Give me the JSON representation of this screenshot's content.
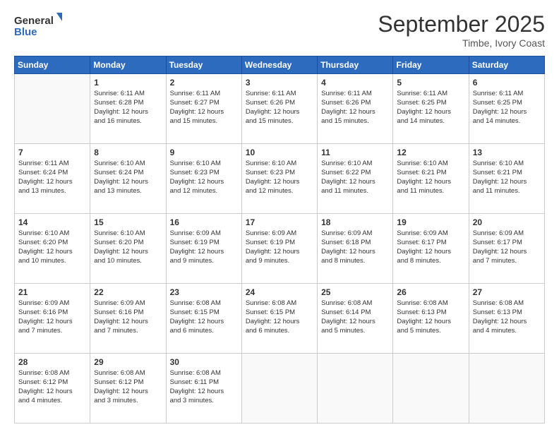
{
  "logo": {
    "line1": "General",
    "line2": "Blue"
  },
  "title": "September 2025",
  "subtitle": "Timbe, Ivory Coast",
  "days": [
    "Sunday",
    "Monday",
    "Tuesday",
    "Wednesday",
    "Thursday",
    "Friday",
    "Saturday"
  ],
  "weeks": [
    [
      {
        "num": "",
        "info": ""
      },
      {
        "num": "1",
        "info": "Sunrise: 6:11 AM\nSunset: 6:28 PM\nDaylight: 12 hours\nand 16 minutes."
      },
      {
        "num": "2",
        "info": "Sunrise: 6:11 AM\nSunset: 6:27 PM\nDaylight: 12 hours\nand 15 minutes."
      },
      {
        "num": "3",
        "info": "Sunrise: 6:11 AM\nSunset: 6:26 PM\nDaylight: 12 hours\nand 15 minutes."
      },
      {
        "num": "4",
        "info": "Sunrise: 6:11 AM\nSunset: 6:26 PM\nDaylight: 12 hours\nand 15 minutes."
      },
      {
        "num": "5",
        "info": "Sunrise: 6:11 AM\nSunset: 6:25 PM\nDaylight: 12 hours\nand 14 minutes."
      },
      {
        "num": "6",
        "info": "Sunrise: 6:11 AM\nSunset: 6:25 PM\nDaylight: 12 hours\nand 14 minutes."
      }
    ],
    [
      {
        "num": "7",
        "info": "Sunrise: 6:11 AM\nSunset: 6:24 PM\nDaylight: 12 hours\nand 13 minutes."
      },
      {
        "num": "8",
        "info": "Sunrise: 6:10 AM\nSunset: 6:24 PM\nDaylight: 12 hours\nand 13 minutes."
      },
      {
        "num": "9",
        "info": "Sunrise: 6:10 AM\nSunset: 6:23 PM\nDaylight: 12 hours\nand 12 minutes."
      },
      {
        "num": "10",
        "info": "Sunrise: 6:10 AM\nSunset: 6:23 PM\nDaylight: 12 hours\nand 12 minutes."
      },
      {
        "num": "11",
        "info": "Sunrise: 6:10 AM\nSunset: 6:22 PM\nDaylight: 12 hours\nand 11 minutes."
      },
      {
        "num": "12",
        "info": "Sunrise: 6:10 AM\nSunset: 6:21 PM\nDaylight: 12 hours\nand 11 minutes."
      },
      {
        "num": "13",
        "info": "Sunrise: 6:10 AM\nSunset: 6:21 PM\nDaylight: 12 hours\nand 11 minutes."
      }
    ],
    [
      {
        "num": "14",
        "info": "Sunrise: 6:10 AM\nSunset: 6:20 PM\nDaylight: 12 hours\nand 10 minutes."
      },
      {
        "num": "15",
        "info": "Sunrise: 6:10 AM\nSunset: 6:20 PM\nDaylight: 12 hours\nand 10 minutes."
      },
      {
        "num": "16",
        "info": "Sunrise: 6:09 AM\nSunset: 6:19 PM\nDaylight: 12 hours\nand 9 minutes."
      },
      {
        "num": "17",
        "info": "Sunrise: 6:09 AM\nSunset: 6:19 PM\nDaylight: 12 hours\nand 9 minutes."
      },
      {
        "num": "18",
        "info": "Sunrise: 6:09 AM\nSunset: 6:18 PM\nDaylight: 12 hours\nand 8 minutes."
      },
      {
        "num": "19",
        "info": "Sunrise: 6:09 AM\nSunset: 6:17 PM\nDaylight: 12 hours\nand 8 minutes."
      },
      {
        "num": "20",
        "info": "Sunrise: 6:09 AM\nSunset: 6:17 PM\nDaylight: 12 hours\nand 7 minutes."
      }
    ],
    [
      {
        "num": "21",
        "info": "Sunrise: 6:09 AM\nSunset: 6:16 PM\nDaylight: 12 hours\nand 7 minutes."
      },
      {
        "num": "22",
        "info": "Sunrise: 6:09 AM\nSunset: 6:16 PM\nDaylight: 12 hours\nand 7 minutes."
      },
      {
        "num": "23",
        "info": "Sunrise: 6:08 AM\nSunset: 6:15 PM\nDaylight: 12 hours\nand 6 minutes."
      },
      {
        "num": "24",
        "info": "Sunrise: 6:08 AM\nSunset: 6:15 PM\nDaylight: 12 hours\nand 6 minutes."
      },
      {
        "num": "25",
        "info": "Sunrise: 6:08 AM\nSunset: 6:14 PM\nDaylight: 12 hours\nand 5 minutes."
      },
      {
        "num": "26",
        "info": "Sunrise: 6:08 AM\nSunset: 6:13 PM\nDaylight: 12 hours\nand 5 minutes."
      },
      {
        "num": "27",
        "info": "Sunrise: 6:08 AM\nSunset: 6:13 PM\nDaylight: 12 hours\nand 4 minutes."
      }
    ],
    [
      {
        "num": "28",
        "info": "Sunrise: 6:08 AM\nSunset: 6:12 PM\nDaylight: 12 hours\nand 4 minutes."
      },
      {
        "num": "29",
        "info": "Sunrise: 6:08 AM\nSunset: 6:12 PM\nDaylight: 12 hours\nand 3 minutes."
      },
      {
        "num": "30",
        "info": "Sunrise: 6:08 AM\nSunset: 6:11 PM\nDaylight: 12 hours\nand 3 minutes."
      },
      {
        "num": "",
        "info": ""
      },
      {
        "num": "",
        "info": ""
      },
      {
        "num": "",
        "info": ""
      },
      {
        "num": "",
        "info": ""
      }
    ]
  ]
}
